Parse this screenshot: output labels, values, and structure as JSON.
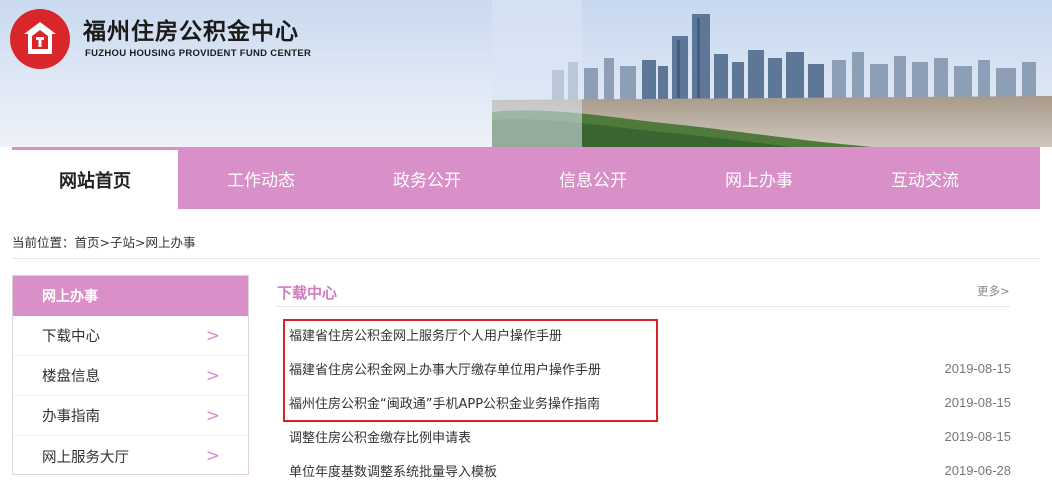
{
  "header": {
    "title": "福州住房公积金中心",
    "subtitle": "FUZHOU HOUSING PROVIDENT FUND CENTER",
    "brand_color": "#d8262b",
    "logo_icon": "house-shield-icon"
  },
  "nav": {
    "items": [
      {
        "label": "网站首页"
      },
      {
        "label": "工作动态"
      },
      {
        "label": "政务公开"
      },
      {
        "label": "信息公开"
      },
      {
        "label": "网上办事"
      },
      {
        "label": "互动交流"
      }
    ],
    "active_index": 0,
    "color": "#d98fc7"
  },
  "breadcrumb": {
    "prefix": "当前位置：",
    "home": "首页",
    "sep1": ">",
    "sub": "子站",
    "sep2": ">",
    "current": "网上办事"
  },
  "sidebar": {
    "header": "网上办事",
    "items": [
      {
        "label": "下载中心",
        "arrow": ">"
      },
      {
        "label": "楼盘信息",
        "arrow": ">"
      },
      {
        "label": "办事指南",
        "arrow": ">"
      },
      {
        "label": "网上服务大厅",
        "arrow": ">"
      }
    ]
  },
  "main": {
    "section_title": "下载中心",
    "more_label": "更多>",
    "documents": [
      {
        "title": "福建省住房公积金网上服务厅个人用户操作手册",
        "date": ""
      },
      {
        "title": "福建省住房公积金网上办事大厅缴存单位用户操作手册",
        "date": "2019-08-15"
      },
      {
        "title": "福州住房公积金“闽政通”手机APP公积金业务操作指南",
        "date": "2019-08-15"
      },
      {
        "title": "调整住房公积金缴存比例申请表",
        "date": "2019-08-15"
      },
      {
        "title": "单位年度基数调整系统批量导入模板",
        "date": "2019-06-28"
      }
    ],
    "highlight_color": "#d3222a"
  }
}
